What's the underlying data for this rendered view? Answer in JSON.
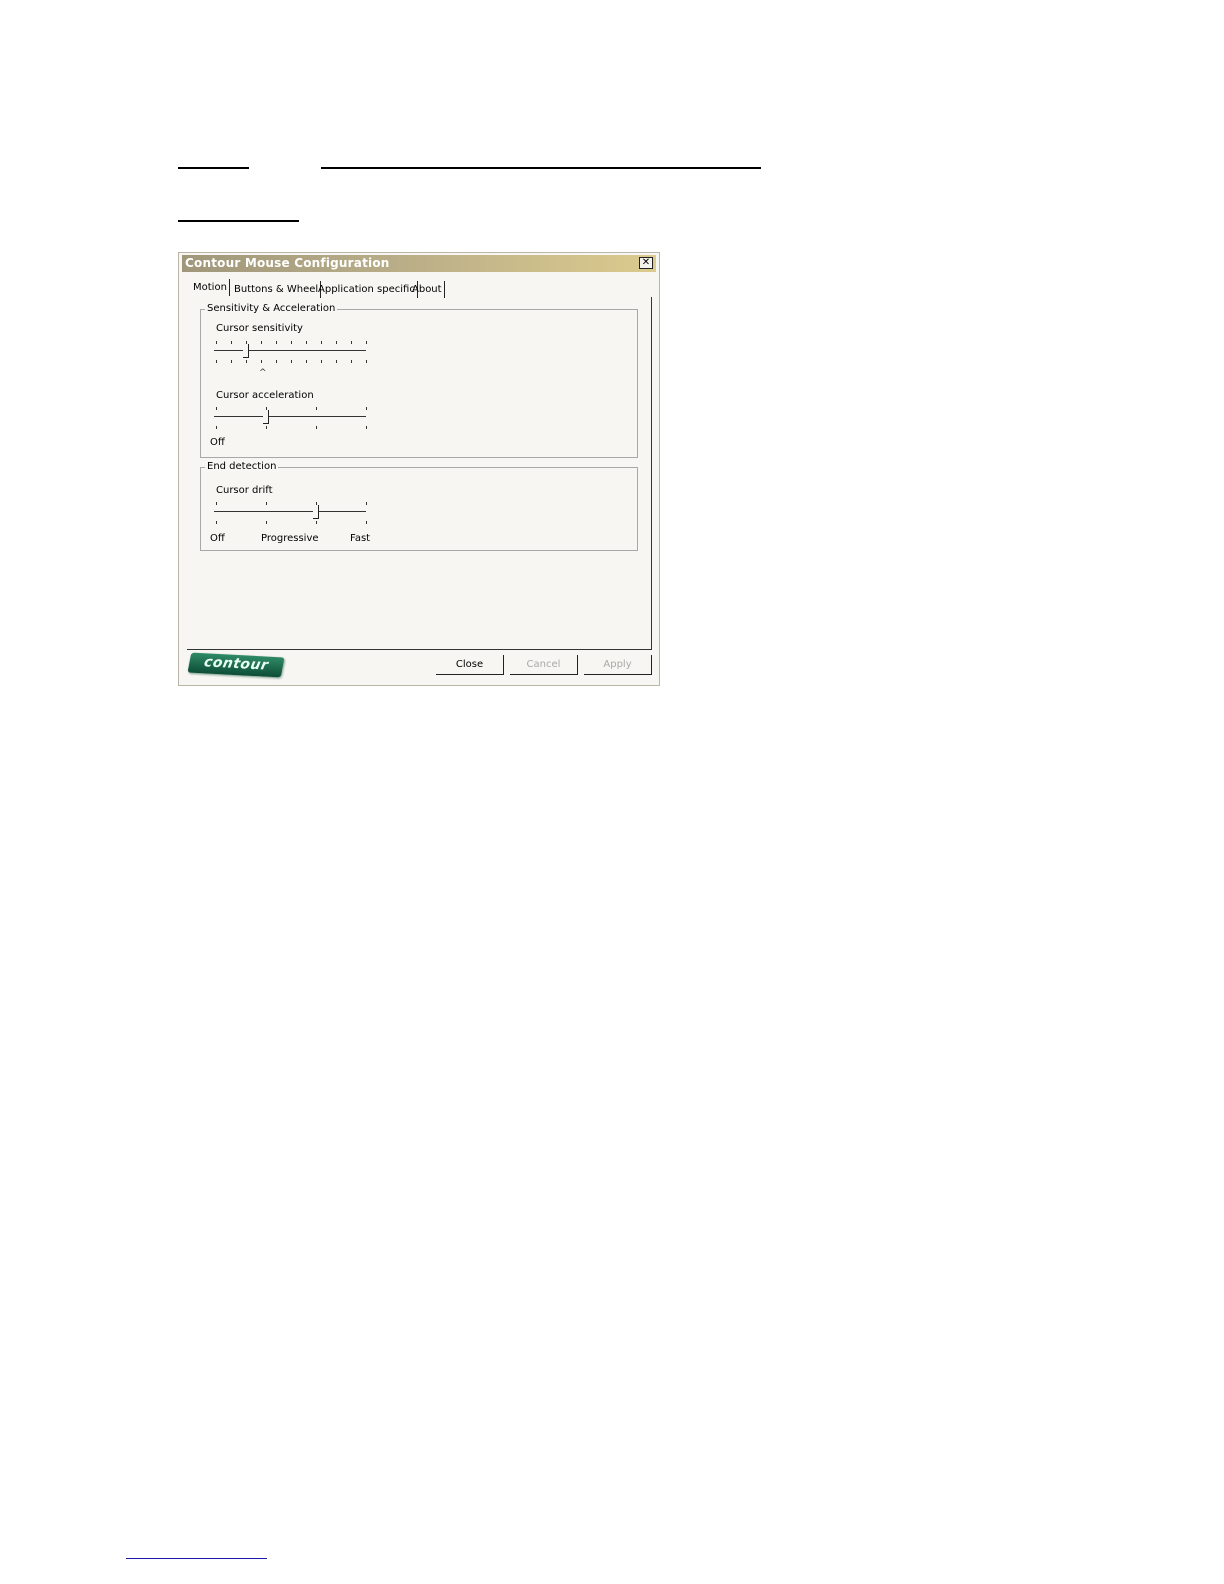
{
  "window": {
    "title": "Contour Mouse Configuration",
    "close_glyph": "✕"
  },
  "tabs": [
    {
      "label": "Motion",
      "active": true
    },
    {
      "label": "Buttons & Wheel",
      "active": false
    },
    {
      "label": "Application specific",
      "active": false
    },
    {
      "label": "About",
      "active": false
    }
  ],
  "sensitivity_group": {
    "title": "Sensitivity & Acceleration",
    "cursor_sensitivity": {
      "label": "Cursor sensitivity",
      "ticks": 11,
      "selected_index": 2,
      "default_marker": "^"
    },
    "cursor_acceleration": {
      "label": "Cursor acceleration",
      "ticks": 4,
      "selected_index": 1,
      "min_label": "Off"
    }
  },
  "end_detection_group": {
    "title": "End detection",
    "cursor_drift": {
      "label": "Cursor drift",
      "ticks": 4,
      "selected_index": 2,
      "tick_labels": [
        "Off",
        "Progressive",
        "Fast"
      ]
    }
  },
  "footer": {
    "logo_text": "contour",
    "close_label": "Close",
    "cancel_label": "Cancel",
    "apply_label": "Apply"
  },
  "colors": {
    "titlebar_start": "#a0977b",
    "titlebar_end": "#dccb8e",
    "window_bg": "#f7f6f2",
    "logo_green": "#1f6e4e",
    "disabled_text": "#a8a8a8"
  }
}
